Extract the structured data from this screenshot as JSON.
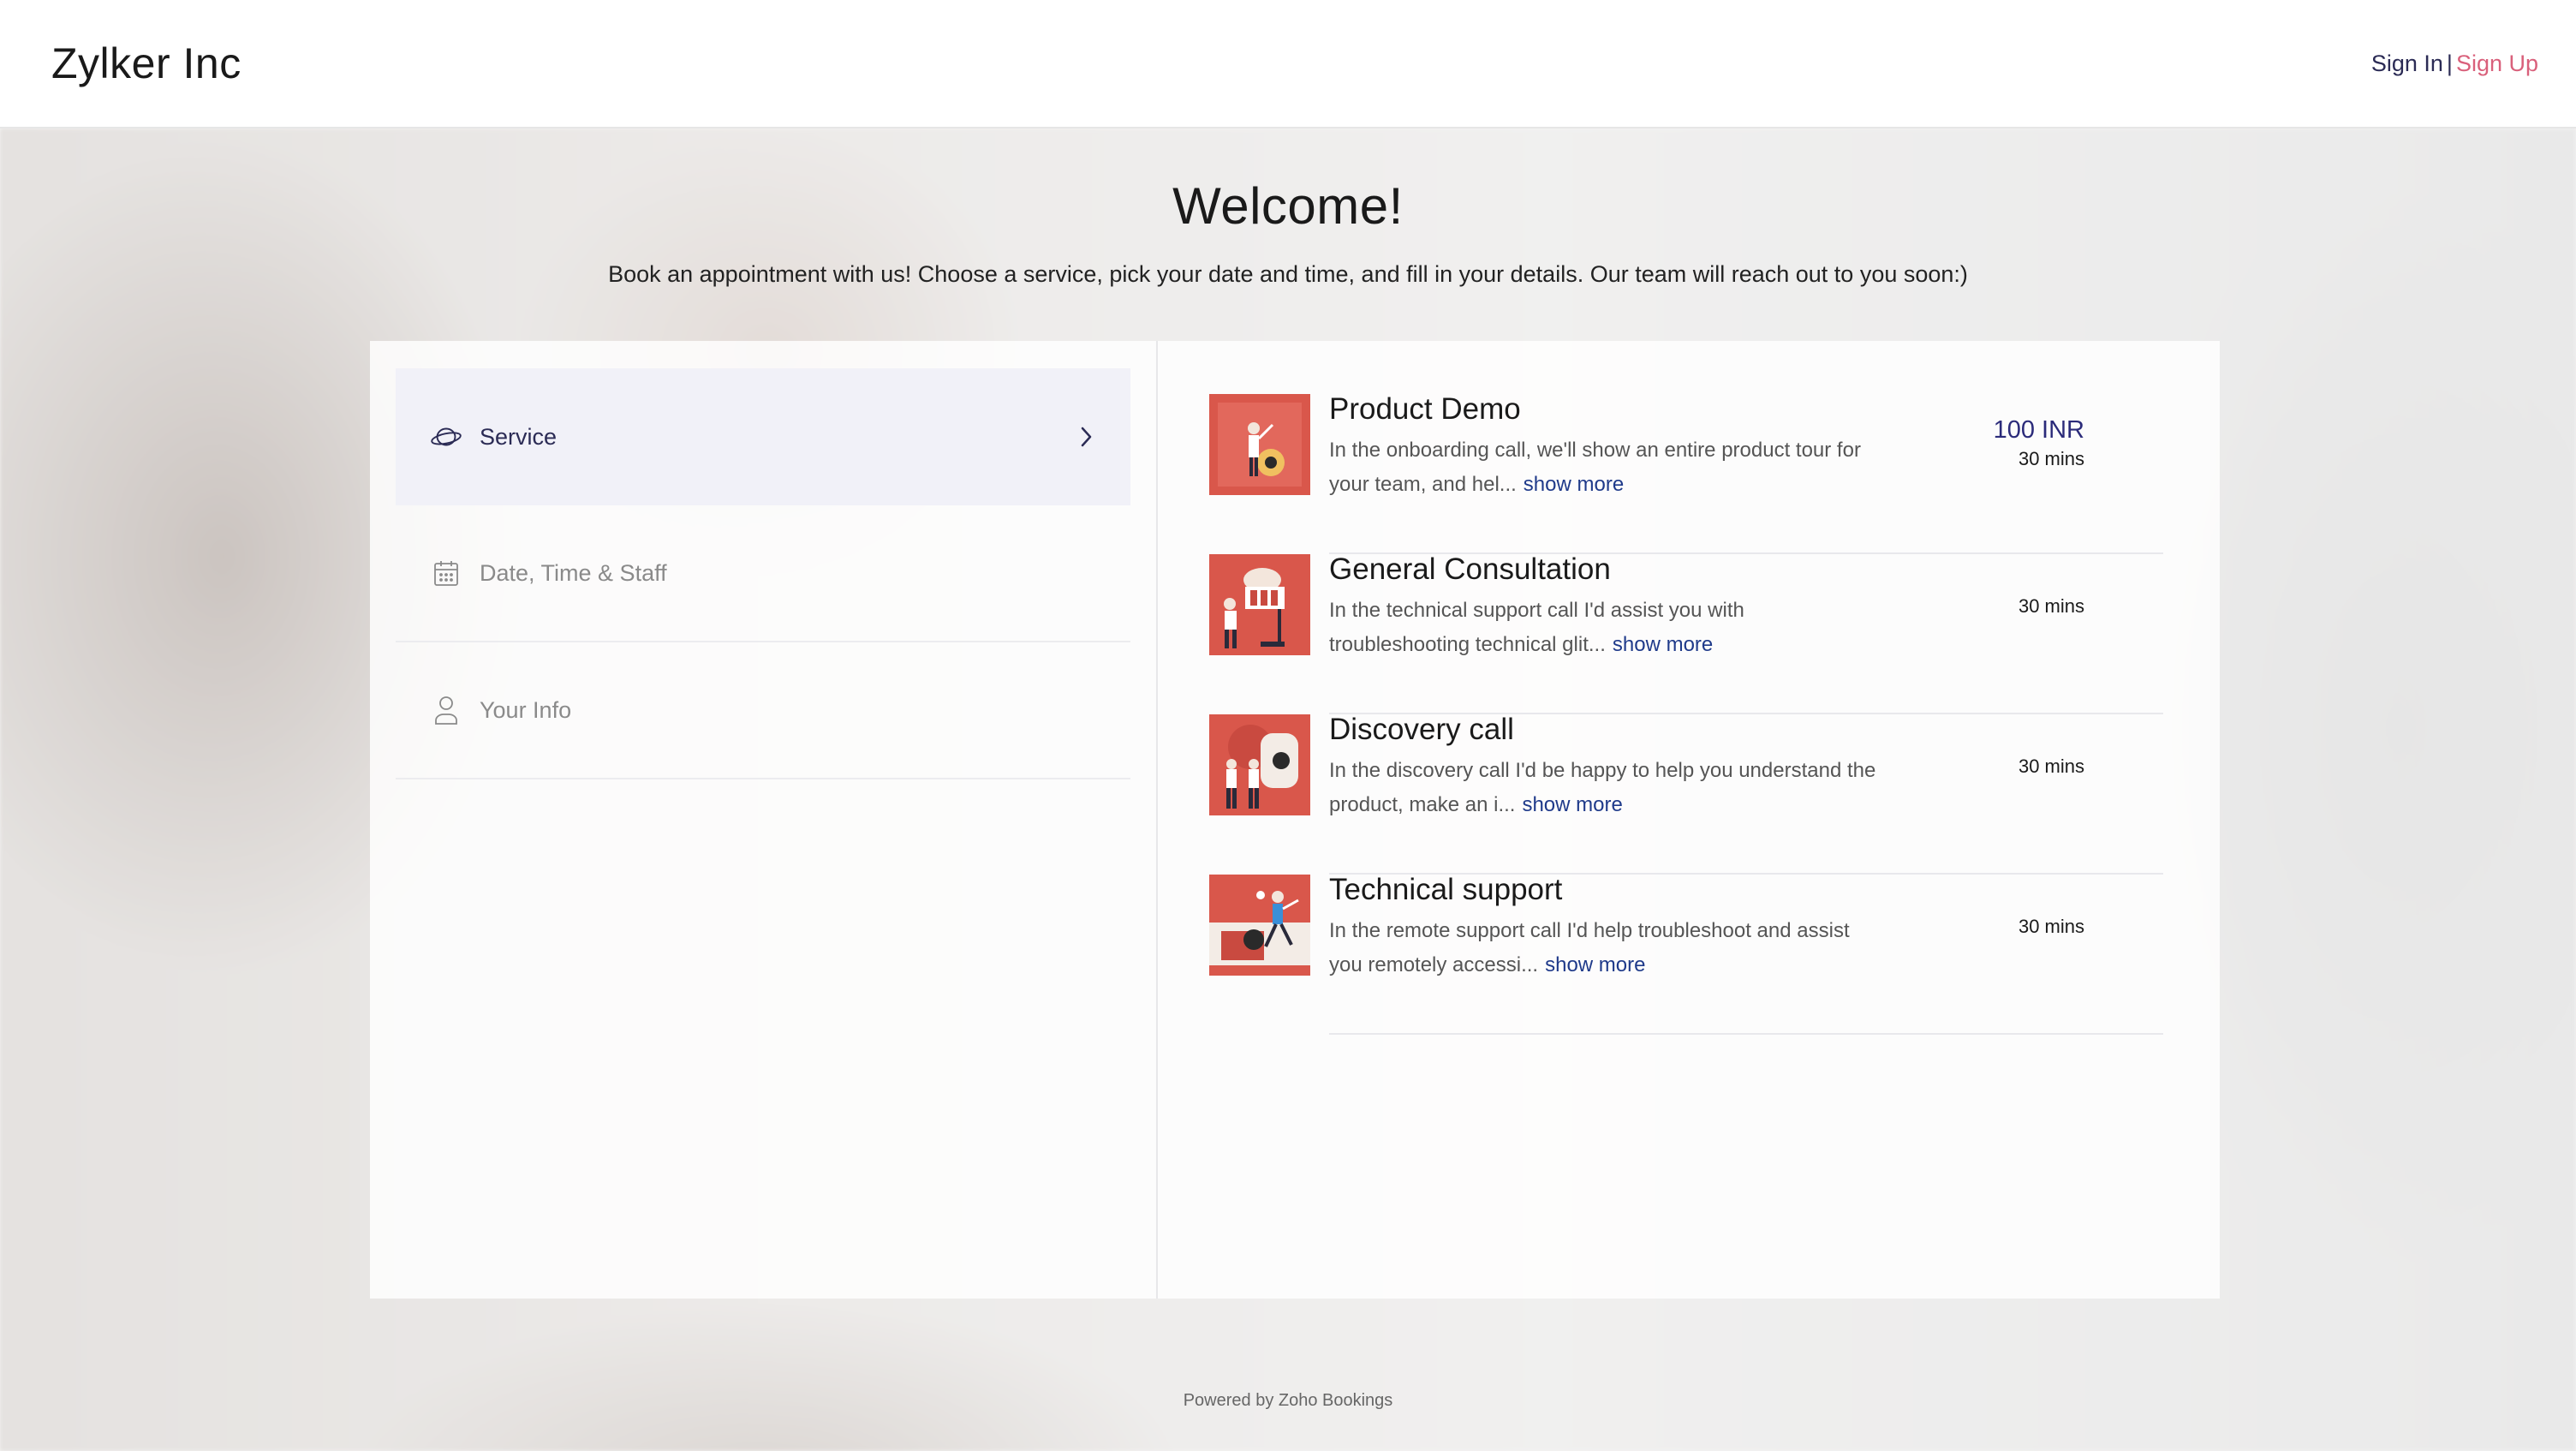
{
  "header": {
    "brand": "Zylker Inc",
    "sign_in": "Sign In",
    "separator": "|",
    "sign_up": "Sign Up"
  },
  "welcome": {
    "title": "Welcome!",
    "subtitle": "Book an appointment with us! Choose a service, pick your date and time, and fill in your details. Our team will reach out to you soon:)"
  },
  "steps": [
    {
      "label": "Service",
      "icon": "planet-icon",
      "active": true
    },
    {
      "label": "Date, Time & Staff",
      "icon": "calendar-icon",
      "active": false
    },
    {
      "label": "Your Info",
      "icon": "user-icon",
      "active": false
    }
  ],
  "services": [
    {
      "name": "Product Demo",
      "description": "In the onboarding call, we'll show an entire product tour for your team, and hel...",
      "show_more": "show more",
      "price": "100 INR",
      "duration": "30 mins"
    },
    {
      "name": "General Consultation",
      "description": "In the technical support call I'd assist you with troubleshooting technical glit...",
      "show_more": "show more",
      "duration": "30 mins"
    },
    {
      "name": "Discovery call",
      "description": "In the discovery call I'd be happy to help you understand the product, make an i...",
      "show_more": "show more",
      "duration": "30 mins"
    },
    {
      "name": "Technical support",
      "description": "In the remote support call I'd help troubleshoot and assist you remotely accessi...",
      "show_more": "show more",
      "duration": "30 mins"
    }
  ],
  "footer": {
    "text": "Powered by Zoho Bookings"
  },
  "colors": {
    "accent_navy": "#2b2b55",
    "sign_up_pink": "#d9607b",
    "link_blue": "#1f3a8a",
    "thumb_red": "#d9574b"
  }
}
